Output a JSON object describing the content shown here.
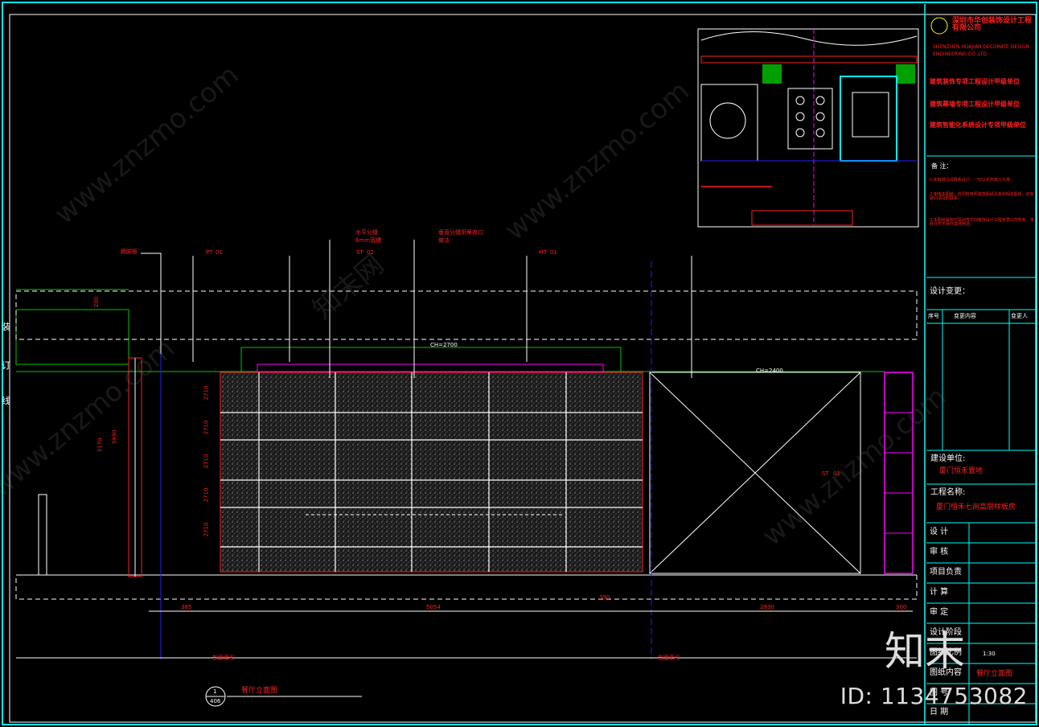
{
  "title_block": {
    "company_cn": "深圳市华创装饰设计工程有限公司",
    "company_en_1": "SHENZHEN HUAJIAN DECORATE DESIGN",
    "company_en_2": "ENGINEERING CO.,LTD.",
    "qualifications": [
      "建筑装饰专项工程设计甲级单位",
      "建筑幕墙专项工程设计甲级单位",
      "建筑智能化系统设计专项甲级单位"
    ],
    "notes_heading": "备 注：",
    "notes": [
      "1.如有疑议请联系设计，一切以实际施工为准。",
      "2.使用本图纸，应同时参照建筑图纸及其他相关图纸，如有疑问请及时联系。",
      "3.本图纸版权归深圳市华创装饰设计工程有限公司所有，未经许可不得作其他用途。"
    ],
    "design_change": "设计变更：",
    "change_cols": [
      "序号",
      "变更内容",
      "变更人"
    ],
    "client_label": "建设单位:",
    "client": "厦门恒禾置地",
    "project_label": "工程名称:",
    "project": "厦门恒禾七尚高层样板房",
    "roles": [
      "设  计",
      "审  核",
      "项目负责",
      "计  算",
      "审  定",
      "设计阶段",
      "图纸比例",
      "图纸内容",
      "图  号",
      "日  期"
    ],
    "scale_value": "1:30",
    "drawing_content": "餐厅立面图"
  },
  "drawing": {
    "ceiling_height_1": "CH=2700",
    "ceiling_height_2": "CH=2400",
    "top_annotations": [
      "踢脚板",
      "水平分缝",
      "6mm宽槽",
      "垂直分缝阴角收口",
      "做法"
    ],
    "tags": [
      "PT",
      "01",
      "ST",
      "02",
      "MT",
      "01",
      "ST",
      "01"
    ],
    "left_side_text": [
      "装",
      "订",
      "线"
    ],
    "dims_bottom": [
      "385",
      "5054",
      "2930",
      "390",
      "300"
    ],
    "dims_left": [
      "3170",
      "3490",
      "200"
    ],
    "dims_vertical_panel": [
      "2710",
      "2710",
      "2710",
      "2710",
      "2710"
    ],
    "section_refs": [
      "剖面索引",
      "剖面索引"
    ],
    "view_title": "餐厅立面图",
    "view_number": "1",
    "view_sheet": "406"
  },
  "watermark": {
    "site": "www.znzmo.com",
    "brand": "知末网",
    "logo_text": "知末",
    "id_label": "ID: 1134753082"
  },
  "colors": {
    "background": "#000000",
    "frame": "#00ffff",
    "red": "#ff2020",
    "green": "#00c800",
    "magenta": "#ff00ff",
    "blue": "#2020ff"
  }
}
